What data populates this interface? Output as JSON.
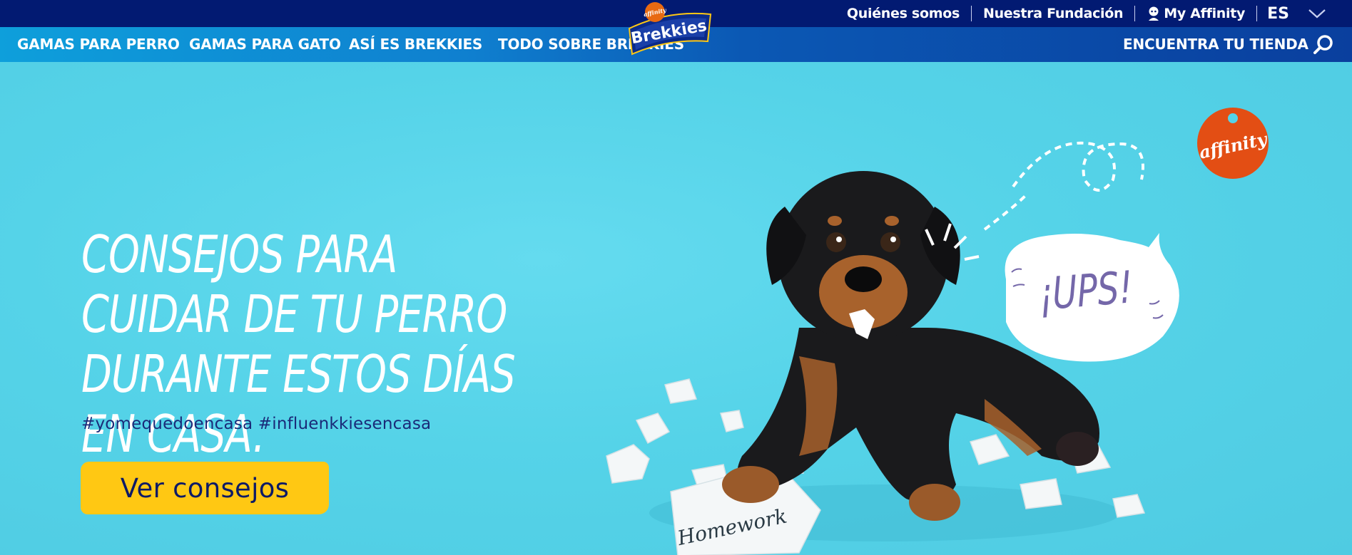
{
  "top_bar": {
    "links": [
      "Quiénes somos",
      "Nuestra Fundación"
    ],
    "my_affinity": "My Affinity",
    "language": "ES"
  },
  "nav": {
    "items": [
      "GAMAS PARA PERRO",
      "GAMAS PARA GATO",
      "ASÍ ES BREKKIES",
      "TODO SOBRE BREKKIES"
    ],
    "store_locator": "ENCUENTRA TU TIENDA"
  },
  "brand": {
    "logo_name": "Brekkies",
    "logo_sub": "affinity"
  },
  "hero": {
    "title": "CONSEJOS PARA CUIDAR DE TU PERRO DURANTE ESTOS DÍAS EN CASA.",
    "hashtags": "#yomequedoencasa #influenkkiesencasa",
    "cta_label": "Ver consejos",
    "bubble_text": "¡UPS!",
    "paper_text": "Homework",
    "badge_text": "affinity"
  },
  "colors": {
    "top_bar": "#021a72",
    "hero_bg": "#55d3e8",
    "cta_bg": "#ffc813",
    "cta_text": "#0d1a66",
    "badge": "#e34e14"
  }
}
